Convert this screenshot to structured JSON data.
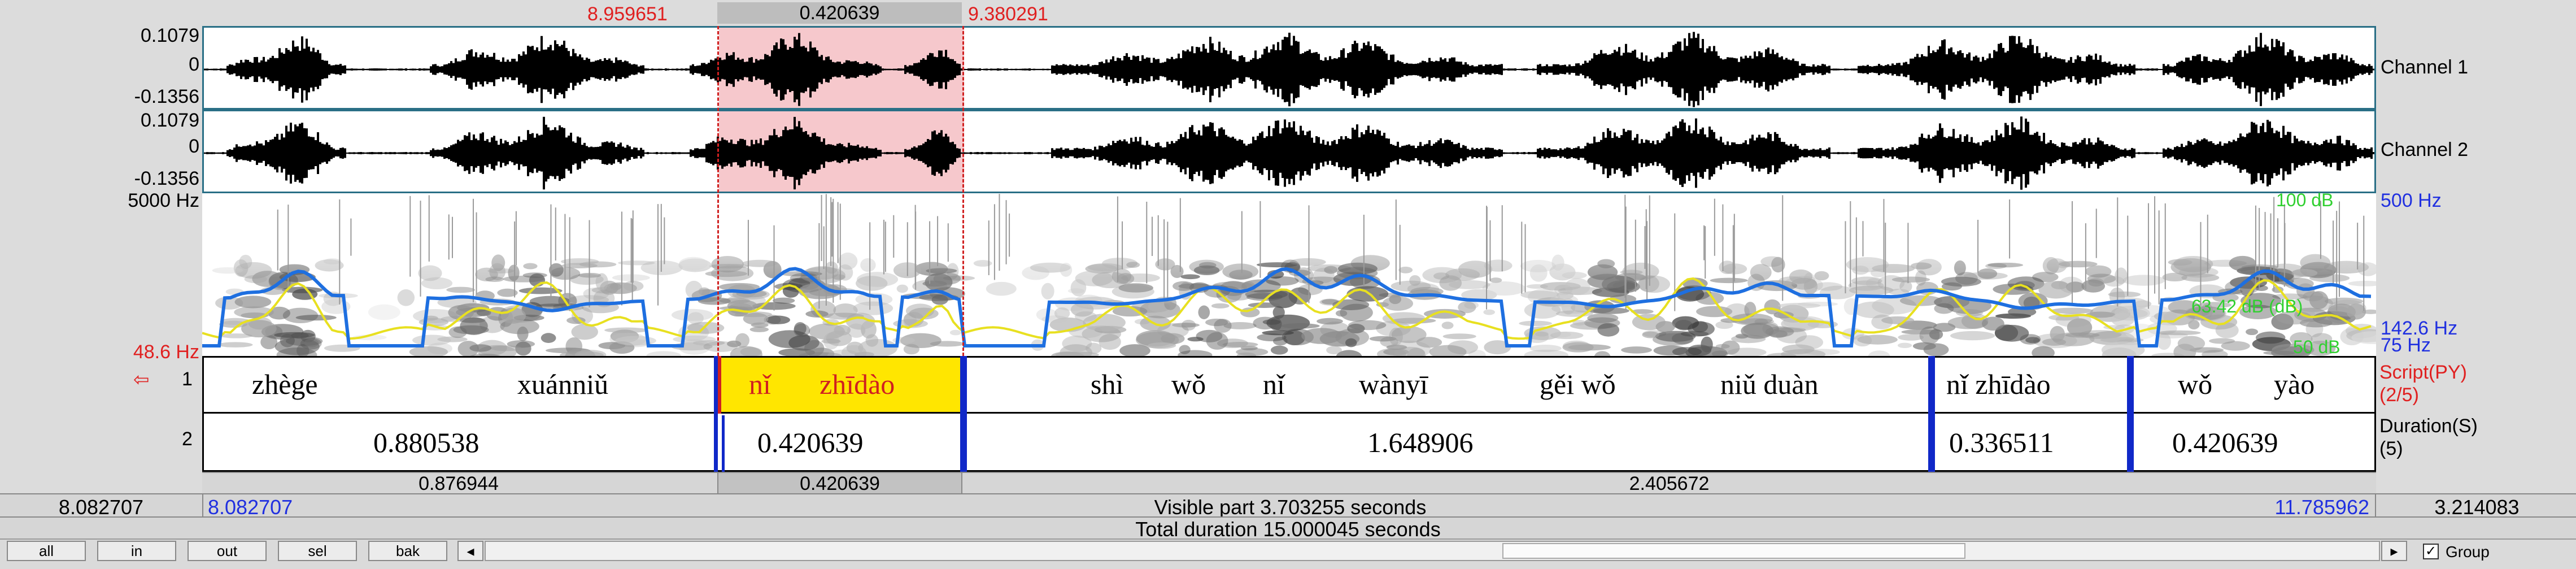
{
  "selection": {
    "start": "8.959651",
    "length": "0.420639",
    "end": "9.380291"
  },
  "channels": [
    {
      "max": "0.1079",
      "zero": "0",
      "min": "-0.1356",
      "label": "Channel 1"
    },
    {
      "max": "0.1079",
      "zero": "0",
      "min": "-0.1356",
      "label": "Channel 2"
    }
  ],
  "spectrogram": {
    "freq_top": "5000 Hz",
    "freq_bottom": "48.6 Hz",
    "db_top": "100 dB",
    "pitch_top": "500 Hz",
    "intensity_mid": "63.42 dB (dB)",
    "pitch_cursor": "142.6 Hz",
    "db_bottom": "50 dB",
    "pitch_bottom": "75 Hz"
  },
  "tiers": [
    {
      "number": "1",
      "arrow": "⇦",
      "name": "Script(PY)",
      "count": "(2/5)",
      "segments": [
        "zhège",
        "xuánniǔ",
        "nǐ",
        "zhīdào",
        "shì",
        "wǒ",
        "nǐ",
        "wànyī",
        "gěi wǒ",
        "niǔ duàn",
        "nǐ zhīdào",
        "wǒ",
        "yào"
      ]
    },
    {
      "number": "2",
      "name": "Duration(S)",
      "count": "(5)",
      "segments": [
        "0.880538",
        "0.420639",
        "1.648906",
        "0.336511",
        "0.420639"
      ]
    }
  ],
  "intervals": {
    "left": "0.876944",
    "selection": "0.420639",
    "right": "2.405672"
  },
  "visible": {
    "left_time": "8.082707",
    "window_start": "8.082707",
    "text": "Visible part 3.703255 seconds",
    "window_end": "11.785962",
    "right_time": "3.214083"
  },
  "total": "Total duration 15.000045 seconds",
  "buttons": [
    "all",
    "in",
    "out",
    "sel",
    "bak"
  ],
  "scroll_left_icon": "◂",
  "scroll_right_icon": "▸",
  "group_check": "✓",
  "group_label": "Group",
  "colors": {
    "selection": "#f6c8cc",
    "highlight": "#ffe600",
    "boundary": "#1028c8",
    "pitch": "#1e6fe0",
    "intensity": "#e8e020"
  }
}
